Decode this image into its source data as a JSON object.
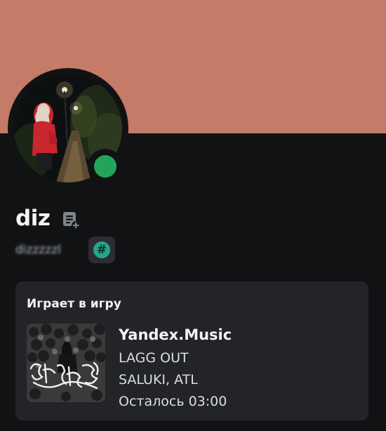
{
  "colors": {
    "banner": "#c47b68",
    "background": "#111214",
    "card": "#232428",
    "status_online": "#23a559",
    "hash_badge": "#23a58c"
  },
  "profile": {
    "display_name": "diz",
    "username": "dizzzzzl",
    "status": "online",
    "note_icon": "note-add-icon",
    "badge_symbol": "#"
  },
  "activity": {
    "header": "Играет в игру",
    "app_name": "Yandex.Music",
    "track": "LAGG OUT",
    "artists": "SALUKI, ATL",
    "remaining": "Осталось 03:00"
  }
}
